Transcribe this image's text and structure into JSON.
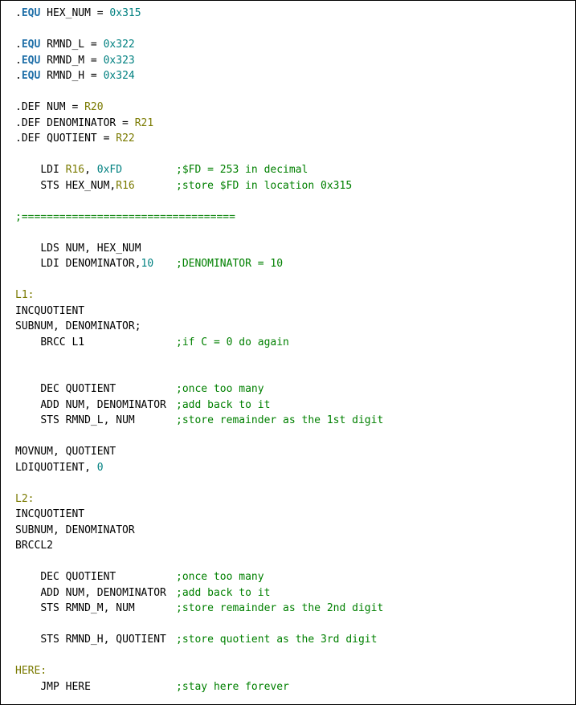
{
  "syntax_colors": {
    "directive": "#1f6fa8",
    "register_label": "#7a7a00",
    "number": "#008080",
    "comment": "#008000",
    "plain": "#000000"
  },
  "equ_directives": [
    {
      "name": "HEX_NUM",
      "value": "0x315"
    },
    {
      "name": "RMND_L",
      "value": "0x322"
    },
    {
      "name": "RMND_M",
      "value": "0x323"
    },
    {
      "name": "RMND_H",
      "value": "0x324"
    }
  ],
  "def_directives": [
    {
      "name": "NUM",
      "reg": "R20"
    },
    {
      "name": "DENOMINATOR",
      "reg": "R21"
    },
    {
      "name": "QUOTIENT",
      "reg": "R22"
    }
  ],
  "init_block": [
    {
      "op": "LDI",
      "args": "R16, 0xFD",
      "comment": ";$FD = 253 in decimal"
    },
    {
      "op": "STS",
      "args": "HEX_NUM,R16",
      "comment": ";store $FD in location 0x315"
    }
  ],
  "separator": ";==================================",
  "setup_block": [
    {
      "op": "LDS",
      "args": "NUM, HEX_NUM",
      "comment": ""
    },
    {
      "op": "LDI",
      "args": "DENOMINATOR,10",
      "comment": ";DENOMINATOR = 10"
    }
  ],
  "label_l1": "L1:",
  "l1_loop": [
    {
      "op": "INC",
      "args": "QUOTIENT",
      "comment": ""
    },
    {
      "op": "SUB",
      "args": "NUM, DENOMINATOR;",
      "comment": ""
    },
    {
      "op": "BRCC",
      "args": "L1",
      "comment": ";if C = 0 do again"
    }
  ],
  "l1_after": [
    {
      "op": "DEC",
      "args": "QUOTIENT",
      "comment": ";once too many"
    },
    {
      "op": "ADD",
      "args": "NUM, DENOMINATOR",
      "comment": ";add back to it"
    },
    {
      "op": "STS",
      "args": "RMND_L, NUM",
      "comment": ";store remainder as the 1st digit"
    }
  ],
  "l1_tail": [
    {
      "op": "MOV",
      "args": "NUM, QUOTIENT",
      "comment": ""
    },
    {
      "op": "LDI",
      "args": "QUOTIENT, 0",
      "comment": ""
    }
  ],
  "label_l2": "L2:",
  "l2_loop": [
    {
      "op": "INC",
      "args": "QUOTIENT",
      "comment": ""
    },
    {
      "op": "SUB",
      "args": "NUM, DENOMINATOR",
      "comment": ""
    },
    {
      "op": "BRCC",
      "args": "L2",
      "comment": ""
    }
  ],
  "l2_after": [
    {
      "op": "DEC",
      "args": "QUOTIENT",
      "comment": ";once too many"
    },
    {
      "op": "ADD",
      "args": "NUM, DENOMINATOR",
      "comment": ";add back to it"
    },
    {
      "op": "STS",
      "args": "RMND_M, NUM",
      "comment": ";store remainder as the 2nd digit"
    }
  ],
  "l2_tail": [
    {
      "op": "STS",
      "args": "RMND_H, QUOTIENT",
      "comment": ";store quotient as the 3rd digit"
    }
  ],
  "label_here": "HERE:",
  "here_block": [
    {
      "op": "JMP",
      "args": "HERE",
      "comment": ";stay here forever"
    }
  ],
  "tokens": {
    "dot": ".",
    "equ": "EQU",
    "def": "DEF",
    "eq": " = "
  }
}
